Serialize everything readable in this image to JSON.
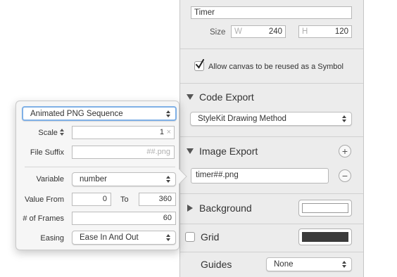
{
  "inspector": {
    "name_value": "Timer",
    "size_label": "Size",
    "width_prefix": "W",
    "width_value": "240",
    "height_prefix": "H",
    "height_value": "120",
    "allow_symbol_label": "Allow canvas to be reused as a Symbol",
    "allow_symbol_checked": true,
    "code_export": {
      "title": "Code Export",
      "method": "StyleKit Drawing Method"
    },
    "image_export": {
      "title": "Image Export",
      "filename": "timer##.png",
      "add_glyph": "+",
      "remove_glyph": "−"
    },
    "background": {
      "title": "Background",
      "color": "#ffffff"
    },
    "grid": {
      "title": "Grid",
      "color": "#3a3a3a"
    },
    "guides": {
      "title": "Guides",
      "value": "None"
    }
  },
  "popover": {
    "format": "Animated PNG Sequence",
    "scale_label": "Scale",
    "scale_value": "1",
    "scale_unit": "×",
    "file_suffix_label": "File Suffix",
    "file_suffix_placeholder": "##.png",
    "variable_label": "Variable",
    "variable_value": "number",
    "value_from_label": "Value From",
    "value_from": "0",
    "to_label": "To",
    "value_to": "360",
    "frames_label": "# of Frames",
    "frames_value": "60",
    "easing_label": "Easing",
    "easing_value": "Ease In And Out"
  },
  "colors": {
    "accent": "#5b9bd5",
    "panel_bg": "#ececec"
  }
}
